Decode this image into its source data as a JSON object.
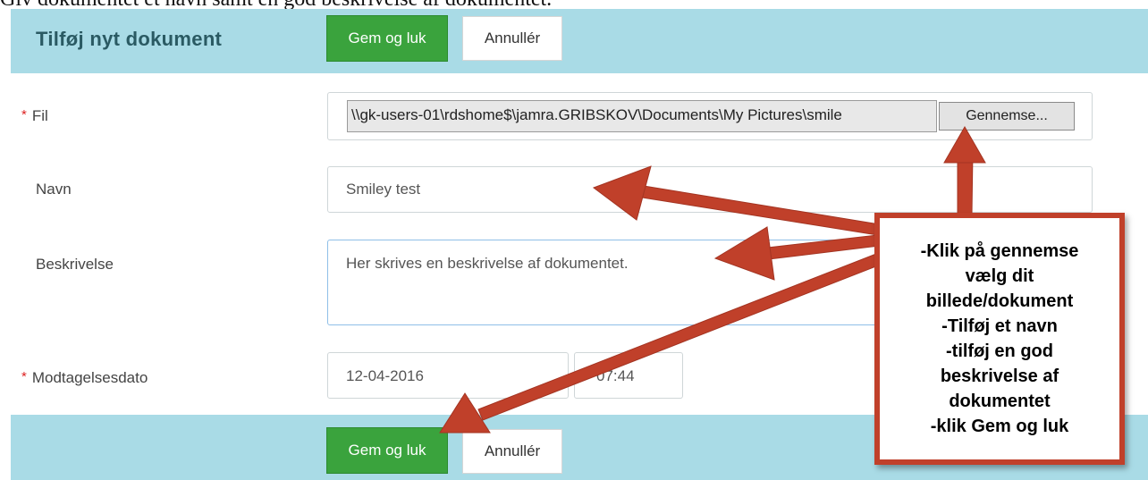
{
  "caption": "Giv dokumentet et navn samt en god beskrivelse af dokumentet.",
  "form": {
    "title": "Tilføj nyt dokument",
    "save_label": "Gem og luk",
    "cancel_label": "Annullér"
  },
  "fields": {
    "file": {
      "label": "Fil",
      "required_marker": "*",
      "value": "\\\\gk-users-01\\rdshome$\\jamra.GRIBSKOV\\Documents\\My Pictures\\smile",
      "browse_label": "Gennemse..."
    },
    "name": {
      "label": "Navn",
      "value": "Smiley test"
    },
    "description": {
      "label": "Beskrivelse",
      "value": "Her skrives en beskrivelse af dokumentet."
    },
    "received": {
      "label": "Modtagelsesdato",
      "required_marker": "*",
      "date": "12-04-2016",
      "time": "07:44"
    }
  },
  "footer": {
    "save_label": "Gem og luk",
    "cancel_label": "Annullér"
  },
  "callout": {
    "lines": [
      "-Klik på gennemse",
      "vælg dit",
      "billede/dokument",
      "-Tilføj et navn",
      "-tilføj en god",
      "beskrivelse af",
      "dokumentet",
      "-klik Gem og luk"
    ]
  },
  "colors": {
    "header_bg": "#a9dbe6",
    "primary_button": "#3aa33d",
    "arrow": "#c0402a",
    "required": "#d22222"
  }
}
